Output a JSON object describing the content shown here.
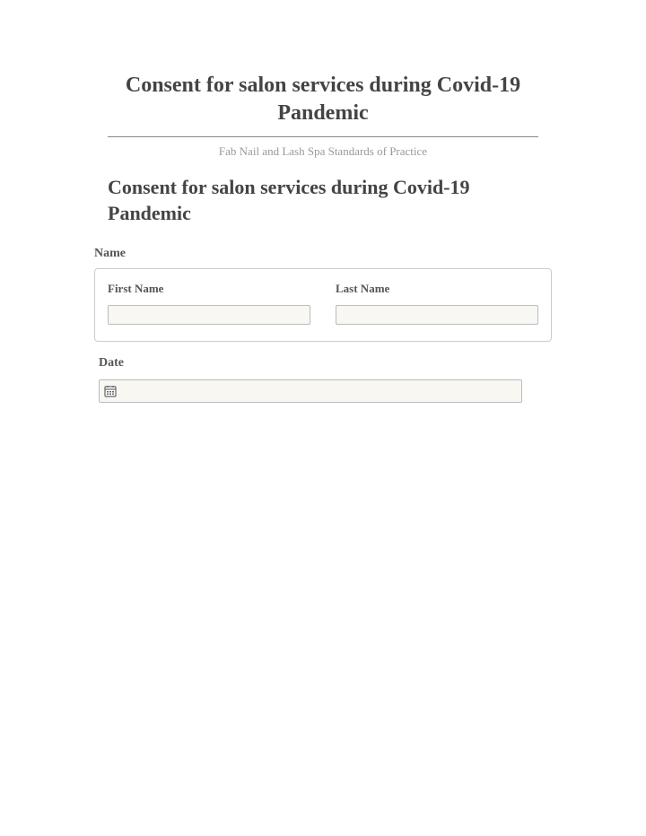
{
  "header": {
    "title": "Consent for salon services during Covid-19 Pandemic",
    "subtitle": "Fab Nail and Lash Spa Standards of Practice"
  },
  "section_heading": "Consent for salon services during Covid-19 Pandemic",
  "form": {
    "name_label": "Name",
    "first_name_label": "First Name",
    "last_name_label": "Last Name",
    "first_name_value": "",
    "last_name_value": "",
    "date_label": "Date",
    "date_value": ""
  }
}
